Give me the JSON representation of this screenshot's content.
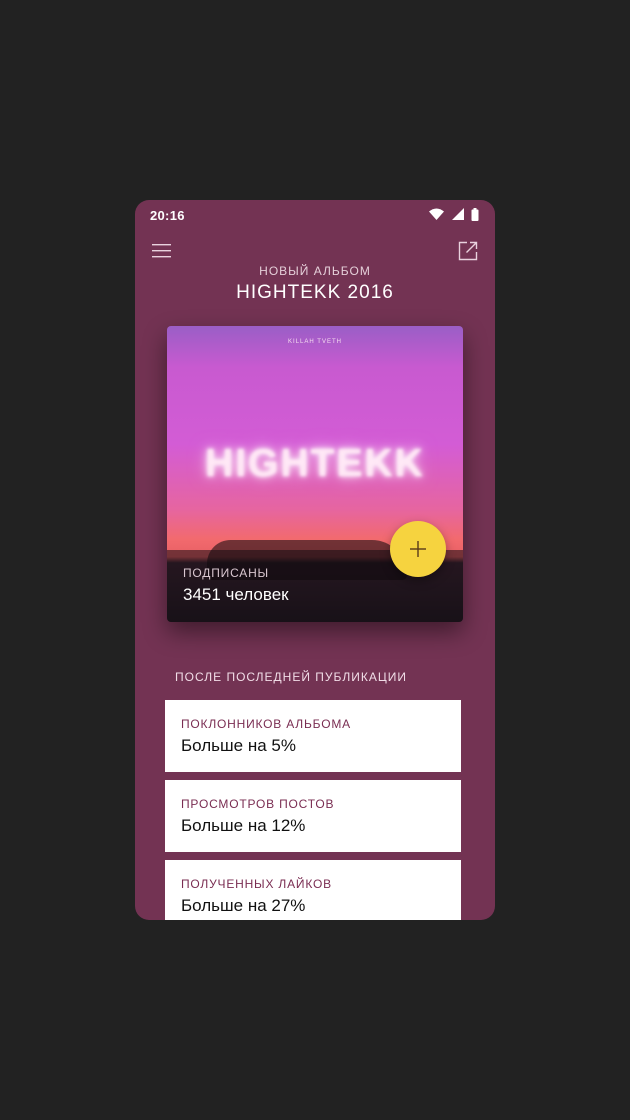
{
  "status_bar": {
    "time": "20:16"
  },
  "header": {
    "subtitle": "НОВЫЙ АЛЬБОМ",
    "title": "HIGHTEKK 2016"
  },
  "album_card": {
    "cover_artist": "KILLAH TVETH",
    "cover_title": "HIGHTEKK",
    "subscribers_label": "ПОДПИСАНЫ",
    "subscribers_value": "3451 человек",
    "fab_icon": "plus-icon",
    "fab_color": "#f6d33f"
  },
  "stats_section": {
    "title": "ПОСЛЕ ПОСЛЕДНЕЙ ПУБЛИКАЦИИ",
    "items": [
      {
        "label": "ПОКЛОННИКОВ АЛЬБОМА",
        "value": "Больше на 5%"
      },
      {
        "label": "ПРОСМОТРОВ ПОСТОВ",
        "value": "Больше на 12%"
      },
      {
        "label": "ПОЛУЧЕННЫХ ЛАЙКОВ",
        "value": "Больше на 27%"
      }
    ]
  },
  "colors": {
    "background": "#733353",
    "accent": "#f6d33f",
    "label": "#7a2d52"
  }
}
